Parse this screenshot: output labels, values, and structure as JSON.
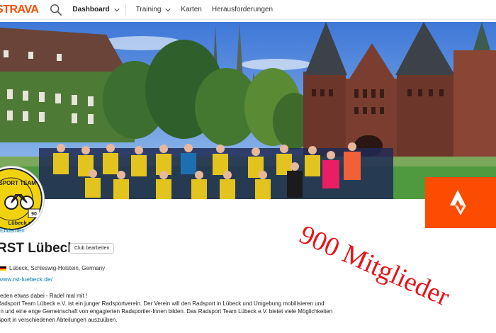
{
  "nav": {
    "logo": "STRAVA",
    "items": [
      {
        "label": "Dashboard",
        "active": true,
        "has_dropdown": true
      },
      {
        "label": "Training",
        "active": false,
        "has_dropdown": true
      },
      {
        "label": "Karten",
        "active": false,
        "has_dropdown": false
      },
      {
        "label": "Herausforderungen",
        "active": false,
        "has_dropdown": false
      }
    ]
  },
  "club": {
    "avatar_text_top": "RADSPORT TEAM",
    "avatar_text_bottom": "Lübeck e.V.",
    "avatar_number": "90",
    "remove_label": "Entfernen",
    "name": "RST Lübeck",
    "edit_label": "Club bearbeiten",
    "location": "Lübeck, Schleswig-Holstein, Germany",
    "website": "www.rst-luebeck.de/",
    "description": [
      "Jeden etwas dabei - Radel mal mit !",
      "Radsport Team Lübeck e.V. ist ein junger Radsportverein. Der Verein will den Radsport in Lübeck und Umgebung mobilisieren und",
      "en und eine enge Gemeinschaft von engagierten Radsportler-Innen bilden. Das Radsport Team Lübeck e.V. bietet viele Möglichkeiten",
      "Sport in verschiedenen Abteilungen auszuüben."
    ]
  },
  "overlay": {
    "text": "900 Mitglieder",
    "color": "#e8141a"
  },
  "colors": {
    "brand": "#fc4c02",
    "link": "#007fb6"
  },
  "icons": {
    "search": "search-icon",
    "chevron": "chevron-down-icon",
    "strava_tile": "strava-logo-icon",
    "flag": "germany-flag-icon"
  }
}
